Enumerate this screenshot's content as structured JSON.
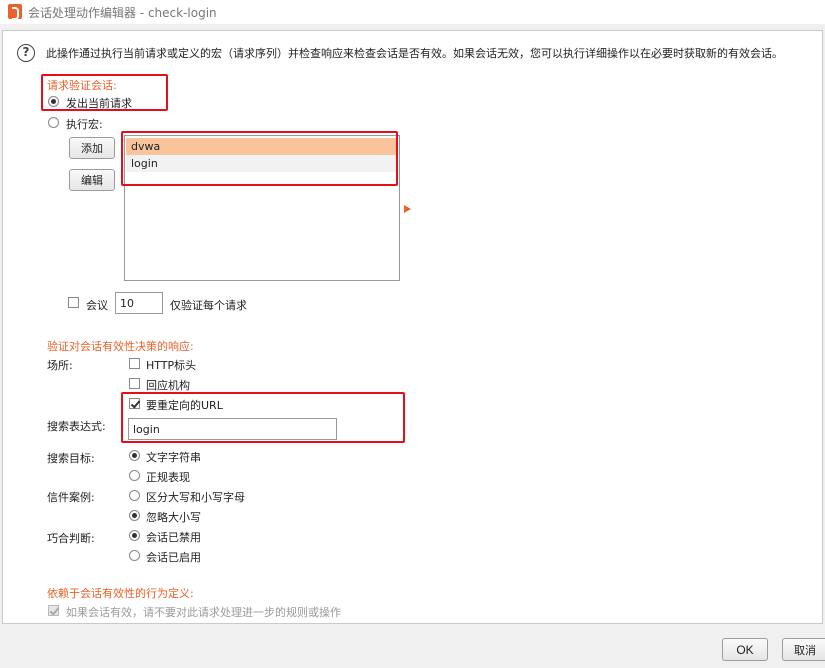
{
  "window": {
    "title": "会话处理动作编辑器 - check-login"
  },
  "info": {
    "text": "此操作通过执行当前请求或定义的宏（请求序列）并检查响应来检查会话是否有效。如果会话无效，您可以执行详细操作以在必要时获取新的有效会话。"
  },
  "request_section": {
    "label": "请求验证会话:",
    "issue_current_label": "发出当前请求",
    "run_macro_label": "执行宏:",
    "add_button": "添加",
    "edit_button": "编辑",
    "macros": [
      "dvwa",
      "login"
    ],
    "every_label": "会议",
    "every_value": "10",
    "every_suffix": "仅验证每个请求"
  },
  "response_section": {
    "label": "验证对会话有效性决策的响应:",
    "location_label": "场所:",
    "http_headers_label": "HTTP标头",
    "response_body_label": "回应机构",
    "redirect_url_label": "要重定向的URL",
    "search_expr_label": "搜索表达式:",
    "search_expr_value": "login",
    "search_target_label": "搜索目标:",
    "literal_string_label": "文字字符串",
    "regex_label": "正规表现",
    "case_label": "信件案例:",
    "case_sensitive_label": "区分大写和小写字母",
    "ignore_case_label": "忽略大小写",
    "match_label": "巧合判断:",
    "session_invalid_label": "会话已禁用",
    "session_valid_label": "会话已启用"
  },
  "behavior_section": {
    "label": "依赖于会话有效性的行为定义:",
    "no_further_label": "如果会话有效，请不要对此请求处理进一步的规则或操作"
  },
  "footer": {
    "ok_label": "OK",
    "cancel_label": "取消"
  },
  "colors": {
    "accent": "#e8622a",
    "highlight": "#e3101a",
    "selection": "#f9c49c"
  }
}
